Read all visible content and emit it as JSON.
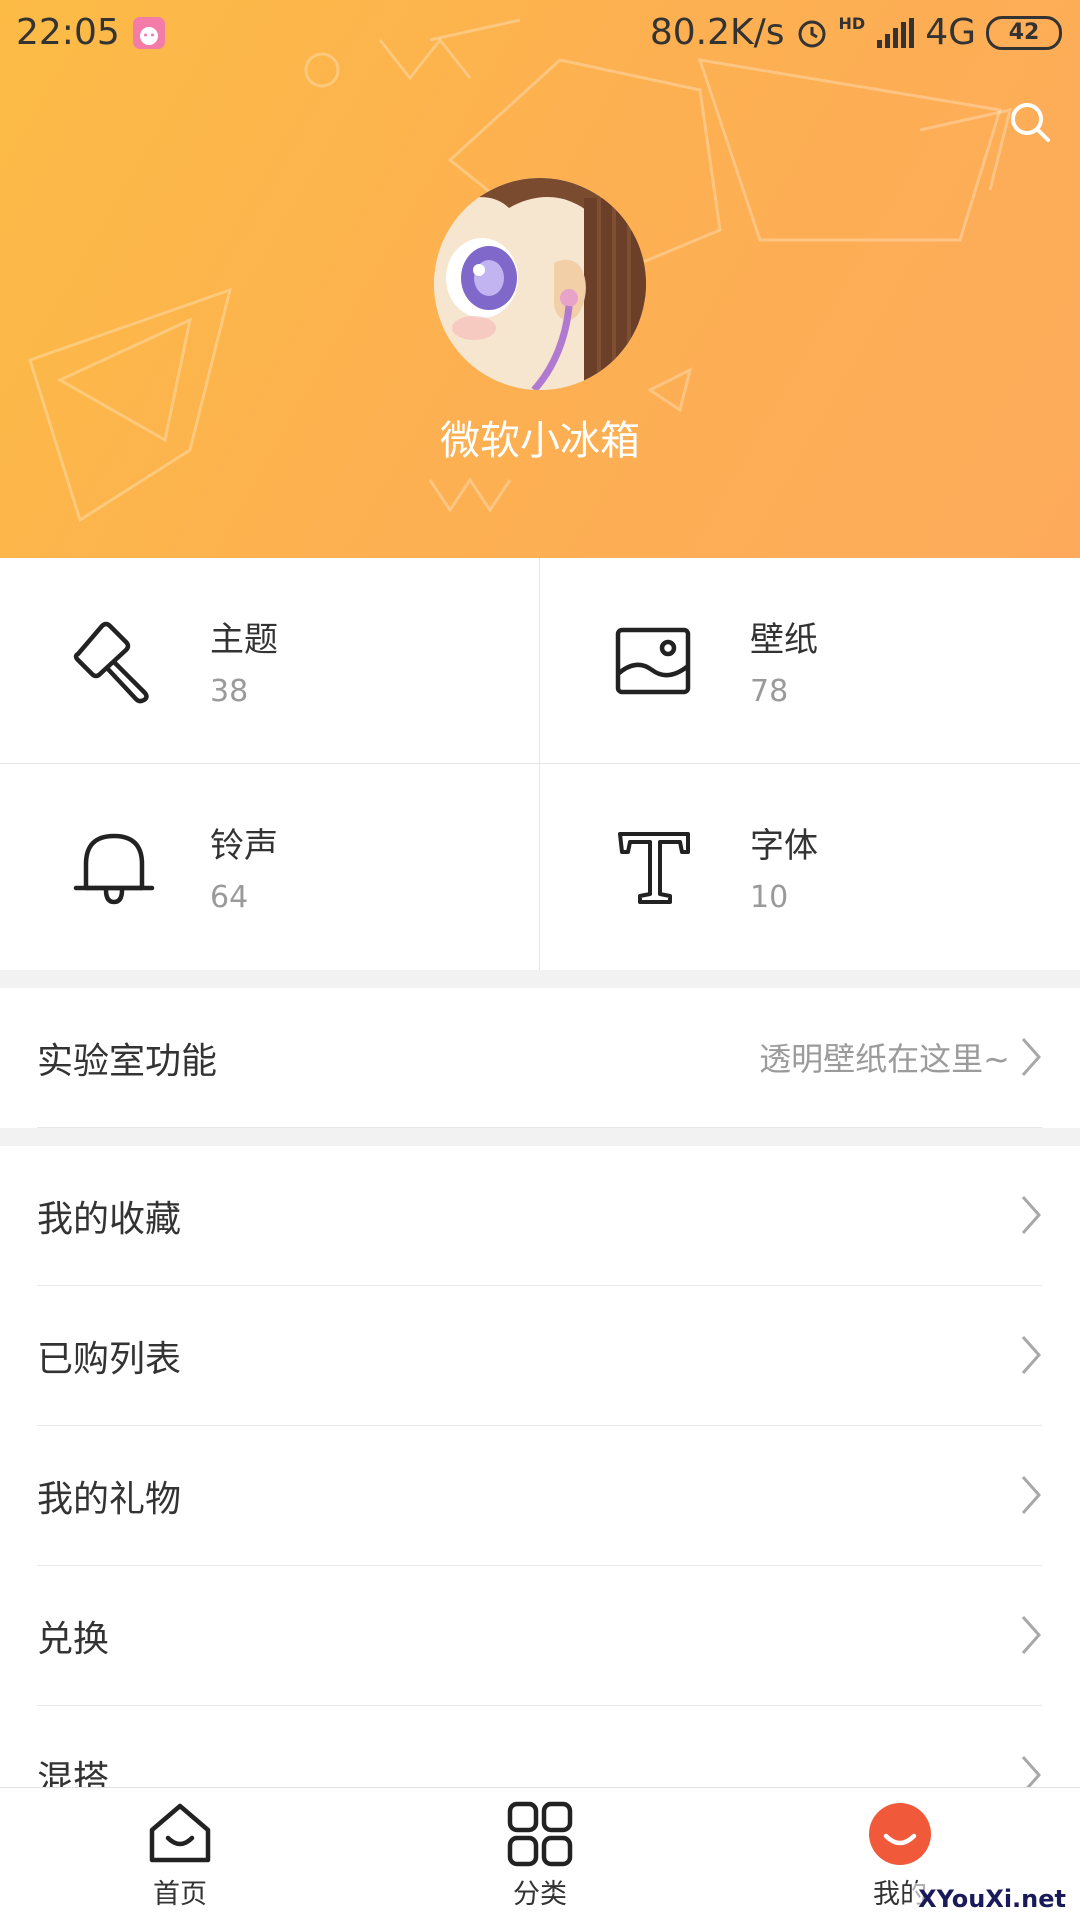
{
  "status_bar": {
    "time": "22:05",
    "network_speed": "80.2K/s",
    "hd": "HD",
    "network_type": "4G",
    "battery": "42"
  },
  "profile": {
    "username": "微软小冰箱"
  },
  "categories": [
    {
      "label": "主题",
      "count": "38",
      "icon": "brush-icon"
    },
    {
      "label": "壁纸",
      "count": "78",
      "icon": "image-icon"
    },
    {
      "label": "铃声",
      "count": "64",
      "icon": "bell-icon"
    },
    {
      "label": "字体",
      "count": "10",
      "icon": "font-icon"
    }
  ],
  "lab": {
    "label": "实验室功能",
    "hint": "透明壁纸在这里~"
  },
  "menu": [
    {
      "label": "我的收藏"
    },
    {
      "label": "已购列表"
    },
    {
      "label": "我的礼物"
    },
    {
      "label": "兑换"
    },
    {
      "label": "混搭"
    }
  ],
  "bottom_nav": [
    {
      "label": "首页",
      "icon": "home-icon"
    },
    {
      "label": "分类",
      "icon": "grid-icon"
    },
    {
      "label": "我的",
      "icon": "profile-icon",
      "active": true
    }
  ],
  "watermark": "XYouXi.net",
  "colors": {
    "header_gradient_start": "#fcbb45",
    "header_gradient_end": "#fdab5b",
    "active_nav": "#f05a3a"
  }
}
